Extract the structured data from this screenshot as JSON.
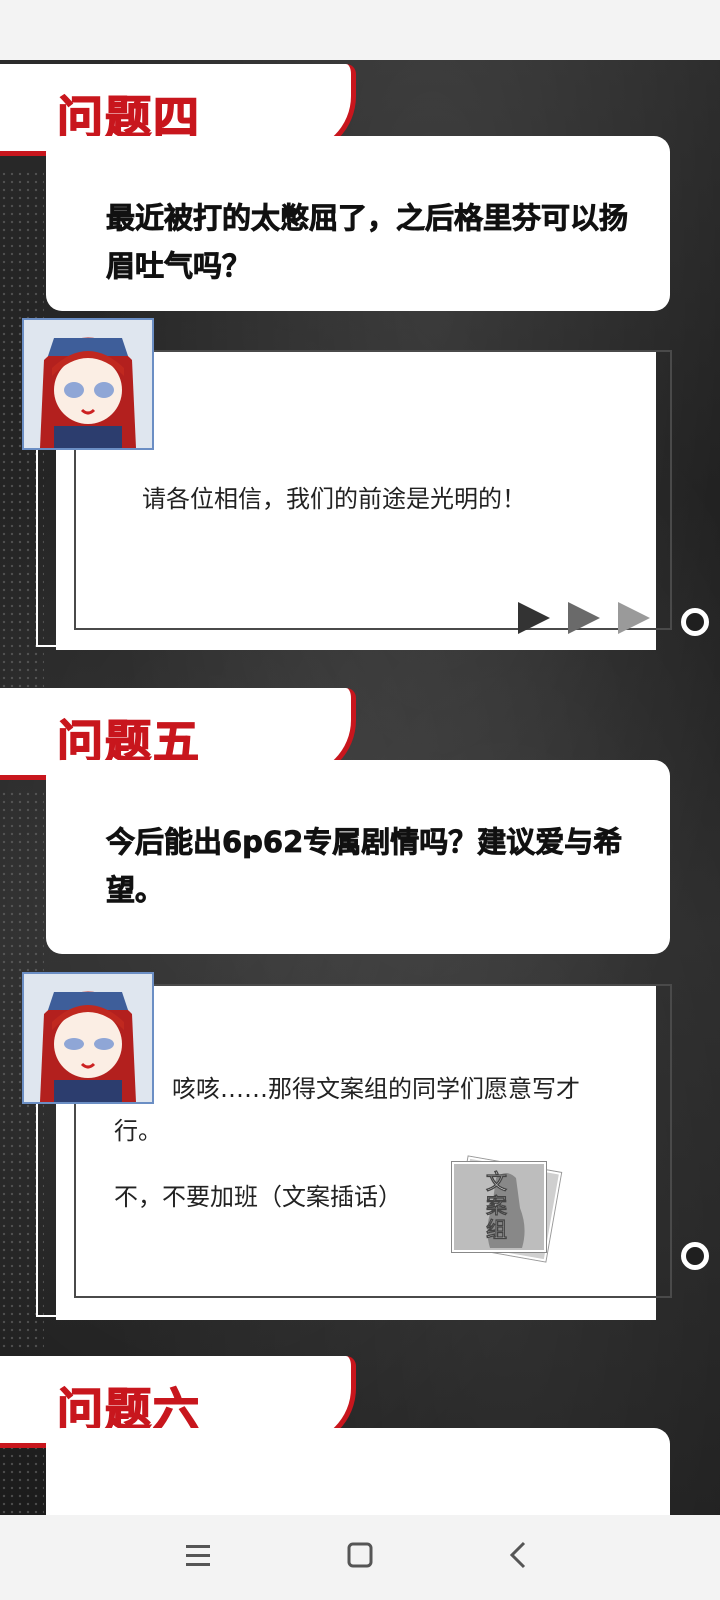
{
  "sections": [
    {
      "title": "问题四",
      "question": "最近被打的太憋屈了，之后格里芬可以扬眉吐气吗？",
      "answer": "请各位相信，我们的前途是光明的！"
    },
    {
      "title": "问题五",
      "question": "今后能出6p62专属剧情吗？建议爱与希望。",
      "answer_line1": "咳咳……那得文案组的同学们愿意写才行。",
      "answer_line2": "不，不要加班（文案插话）",
      "badge": "文案组"
    },
    {
      "title": "问题六"
    }
  ],
  "icons": {
    "avatar": "character-avatar",
    "menu": "menu-icon",
    "home": "home-icon",
    "back": "back-icon"
  },
  "colors": {
    "accent": "#c8161d",
    "background": "#222222",
    "card": "#ffffff"
  }
}
